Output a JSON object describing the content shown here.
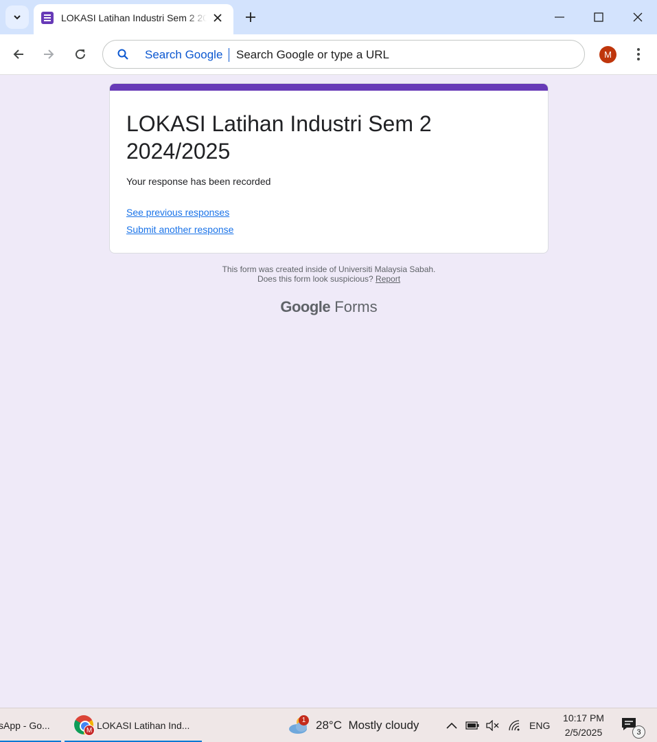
{
  "browser": {
    "tab": {
      "title": "LOKASI Latihan Industri Sem 2 2024/2025"
    },
    "omnibox": {
      "engine_label": "Search Google",
      "placeholder": "Search Google or type a URL"
    },
    "profile_initial": "M",
    "accent_color": "#0b57d0"
  },
  "form": {
    "title": "LOKASI Latihan Industri Sem 2 2024/2025",
    "message": "Your response has been recorded",
    "link_previous": "See previous responses",
    "link_another": "Submit another response",
    "theme_color": "#673ab7"
  },
  "footer": {
    "created_note": "This form was created inside of Universiti Malaysia Sabah.",
    "suspicious_text": "Does this form look suspicious?",
    "report_link": "Report",
    "logo_google": "Google",
    "logo_forms": "Forms"
  },
  "taskbar": {
    "app1_label": "sApp - Go...",
    "app2_label": "LOKASI Latihan Ind...",
    "app2_badge": "M",
    "weather_badge": "1",
    "weather_temp": "28°C",
    "weather_desc": "Mostly cloudy",
    "language": "ENG",
    "time": "10:17 PM",
    "date": "2/5/2025",
    "notification_count": "3"
  },
  "icons": [
    "tab-list-icon",
    "forms-favicon-icon",
    "close-icon",
    "plus-icon",
    "minimize-icon",
    "maximize-icon",
    "back-arrow-icon",
    "forward-arrow-icon",
    "reload-icon",
    "search-icon",
    "kebab-menu-icon",
    "chrome-icon",
    "weather-icon",
    "chevron-up-icon",
    "battery-icon",
    "speaker-muted-icon",
    "wifi-icon",
    "notification-icon"
  ]
}
